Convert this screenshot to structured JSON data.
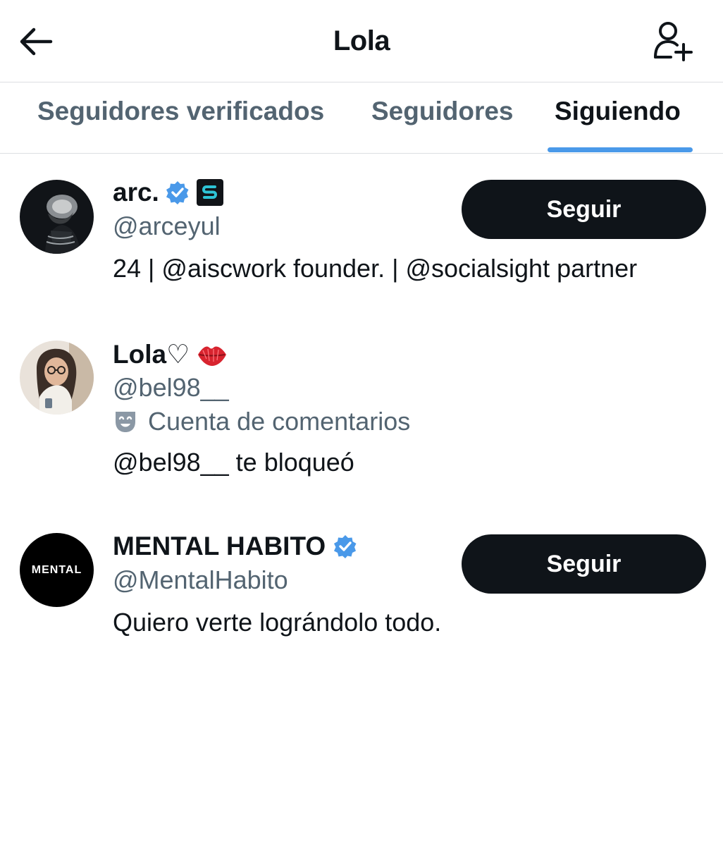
{
  "header": {
    "title": "Lola",
    "back_icon": "arrow-left-icon",
    "add_icon": "add-user-icon"
  },
  "tabs": [
    {
      "label": "Seguidores verificados",
      "active": false
    },
    {
      "label": "Seguidores",
      "active": false
    },
    {
      "label": "Siguiendo",
      "active": true
    }
  ],
  "users": [
    {
      "name": "arc.",
      "handle": "@arceyul",
      "bio": "24 | @aiscwork founder. | @socialsight partner",
      "verified": true,
      "extra_badge": "s-badge-icon",
      "button": "Seguir"
    },
    {
      "name": "Lola♡",
      "handle": "@bel98__",
      "affiliation": "Cuenta de comentarios",
      "affiliation_icon": "theater-mask-icon",
      "status": "@bel98__ te bloqueó",
      "emoji": "lips-icon"
    },
    {
      "name": "MENTAL HABITO",
      "handle": "@MentalHabito",
      "bio": "Quiero verte lográndolo todo.",
      "verified": true,
      "avatar_text": "MENTAL",
      "button": "Seguir"
    }
  ],
  "colors": {
    "accent": "#4a99e9",
    "text_primary": "#0f1419",
    "text_secondary": "#536471",
    "button_bg": "#0f1419"
  }
}
